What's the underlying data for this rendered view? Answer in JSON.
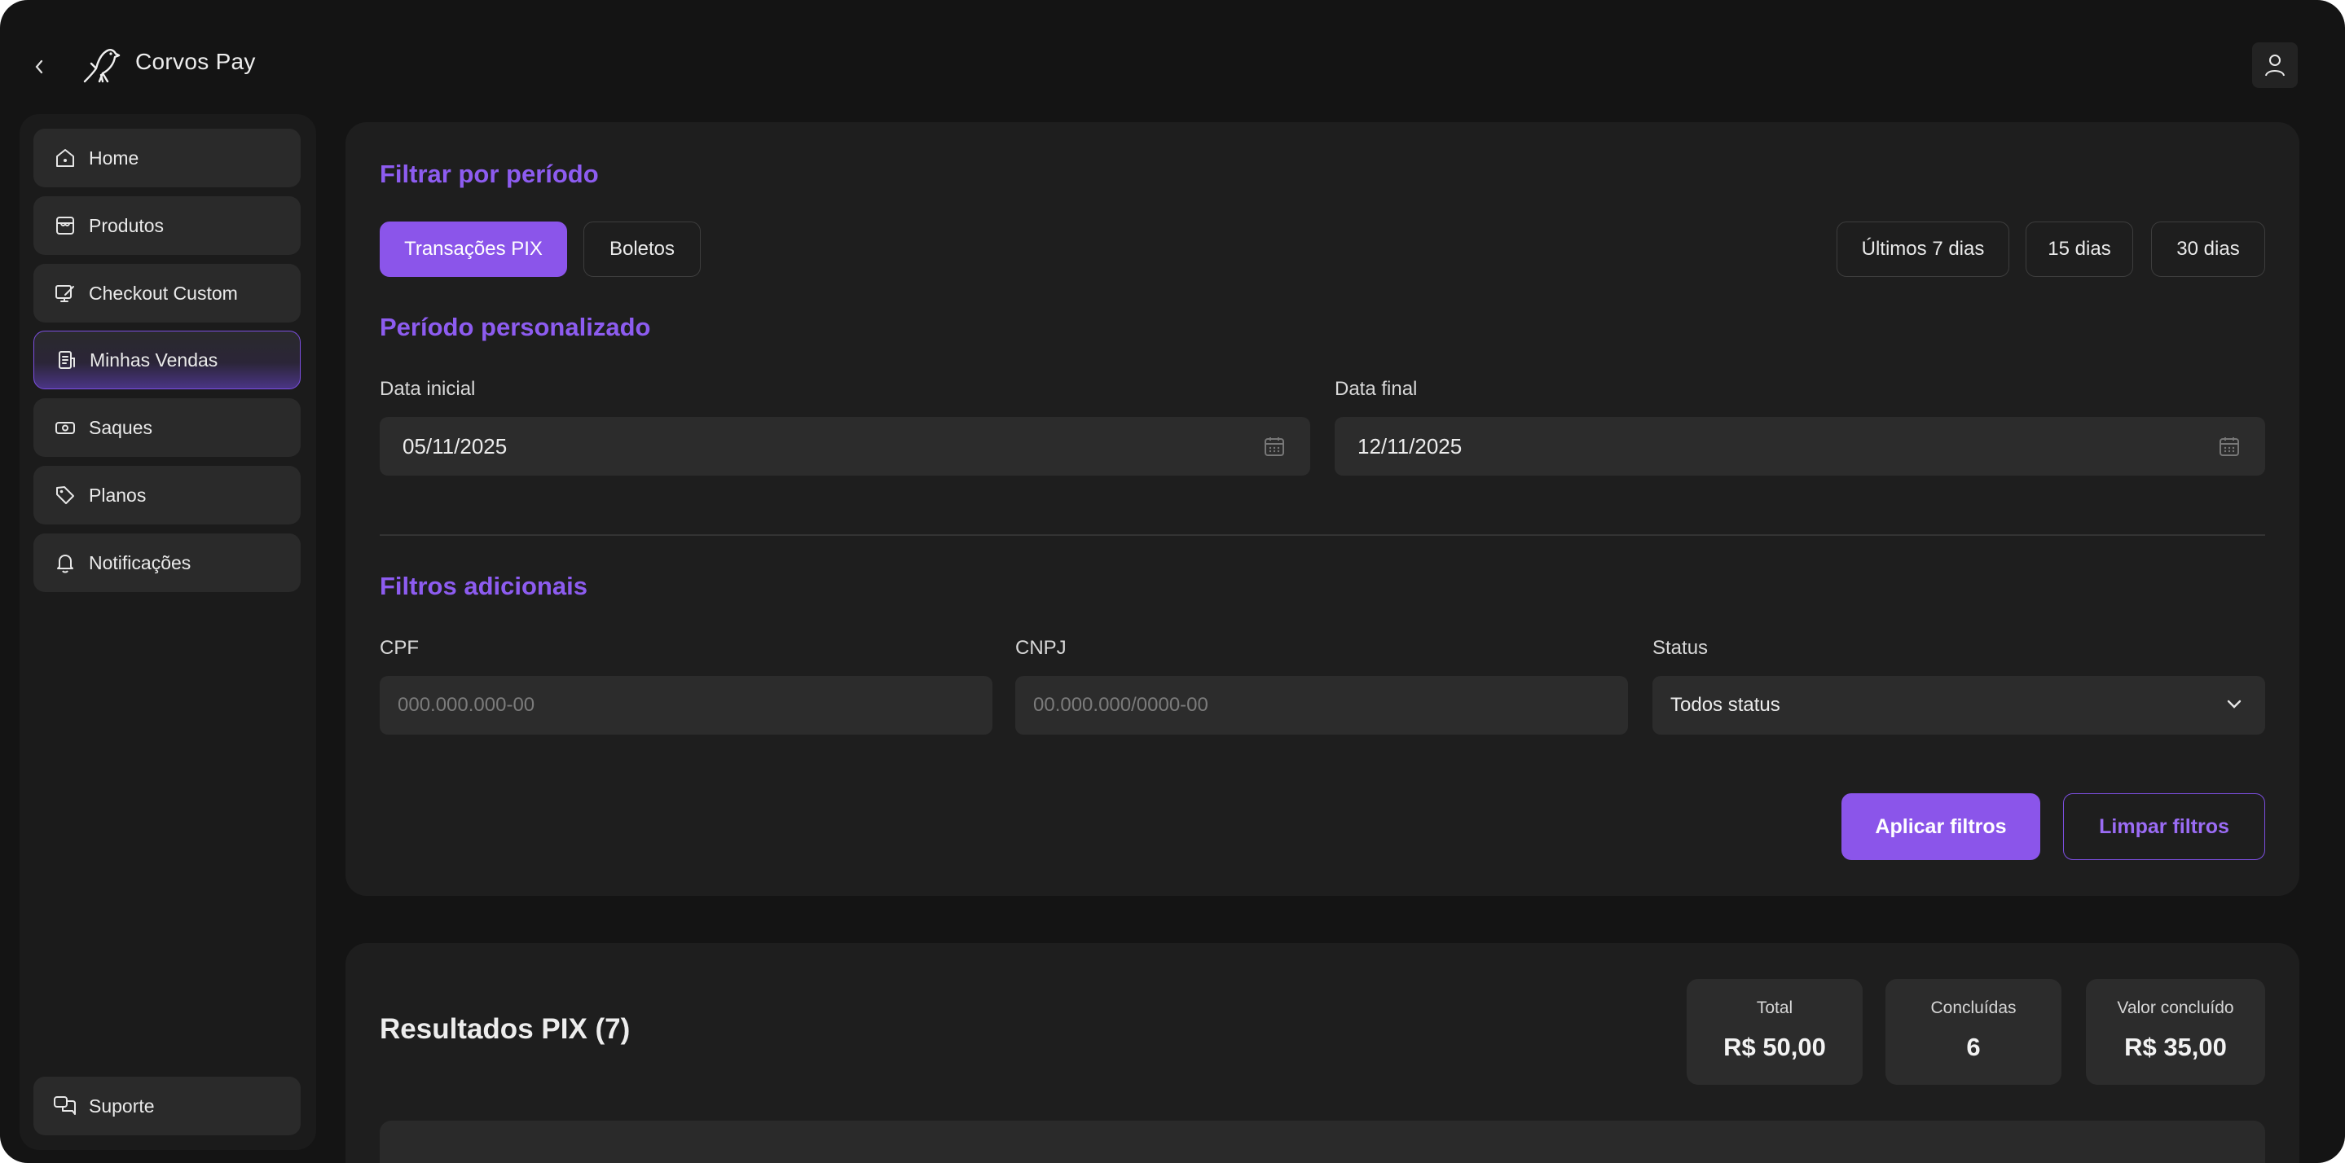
{
  "app": {
    "brand": "Corvos Pay"
  },
  "sidebar": {
    "items": [
      {
        "label": "Home",
        "icon": "home-icon"
      },
      {
        "label": "Produtos",
        "icon": "store-icon"
      },
      {
        "label": "Checkout Custom",
        "icon": "edit-screen-icon"
      },
      {
        "label": "Minhas Vendas",
        "icon": "receipt-icon",
        "active": true
      },
      {
        "label": "Saques",
        "icon": "cash-icon"
      },
      {
        "label": "Planos",
        "icon": "tag-icon"
      },
      {
        "label": "Notificações",
        "icon": "bell-icon"
      }
    ],
    "support": "Suporte"
  },
  "filters": {
    "period_title": "Filtrar por período",
    "tab_pix": "Transações PIX",
    "tab_boletos": "Boletos",
    "quick_7": "Últimos 7 dias",
    "quick_15": "15 dias",
    "quick_30": "30 dias",
    "custom_title": "Período personalizado",
    "start_label": "Data inicial",
    "start_value": "05/11/2025",
    "end_label": "Data final",
    "end_value": "12/11/2025",
    "additional_title": "Filtros adicionais",
    "cpf_label": "CPF",
    "cpf_placeholder": "000.000.000-00",
    "cnpj_label": "CNPJ",
    "cnpj_placeholder": "00.000.000/0000-00",
    "status_label": "Status",
    "status_value": "Todos status",
    "apply": "Aplicar filtros",
    "clear": "Limpar filtros"
  },
  "results": {
    "title": "Resultados PIX (7)",
    "stats": [
      {
        "label": "Total",
        "value": "R$ 50,00"
      },
      {
        "label": "Concluídas",
        "value": "6"
      },
      {
        "label": "Valor concluído",
        "value": "R$ 35,00"
      }
    ]
  },
  "colors": {
    "accent": "#8b55ea",
    "background": "#141414",
    "card": "#1e1e1e"
  }
}
